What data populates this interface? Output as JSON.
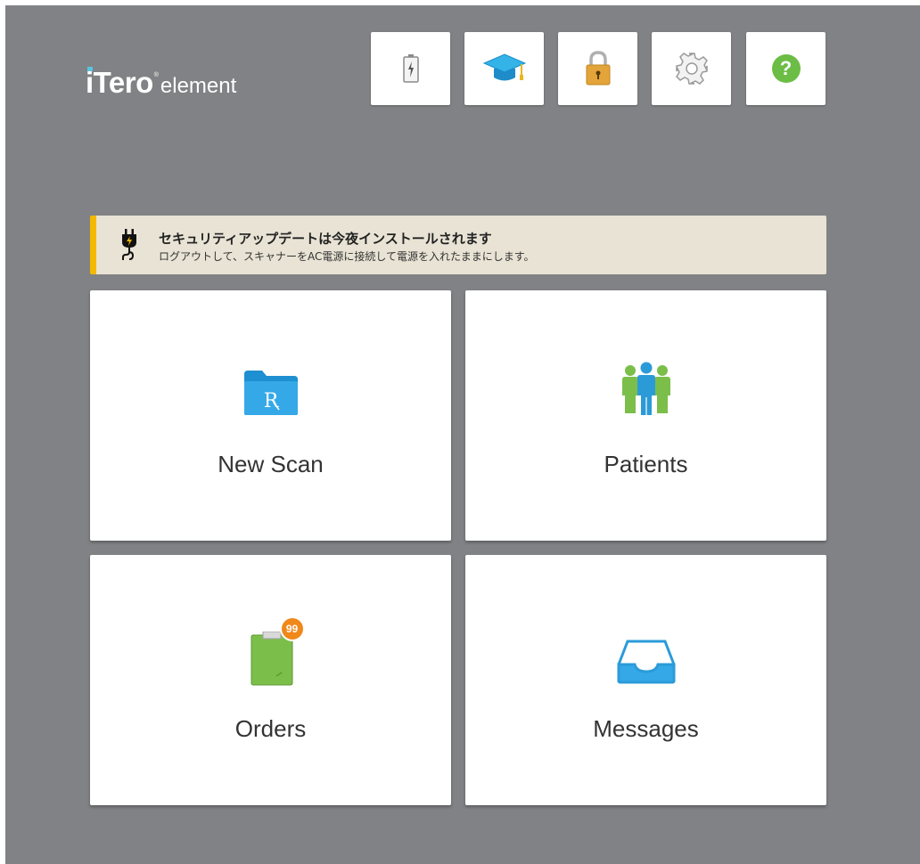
{
  "header": {
    "logo_text": "iTero",
    "logo_registered": "®",
    "logo_suffix": "element"
  },
  "toolbar": {
    "buttons": [
      {
        "name": "battery",
        "icon": "battery-charging-icon"
      },
      {
        "name": "learning",
        "icon": "graduation-cap-icon"
      },
      {
        "name": "lock",
        "icon": "padlock-icon"
      },
      {
        "name": "settings",
        "icon": "gear-icon"
      },
      {
        "name": "help",
        "icon": "question-mark-icon",
        "glyph": "?"
      }
    ]
  },
  "banner": {
    "title": "セキュリティアップデートは今夜インストールされます",
    "text": "ログアウトして、スキャナーをAC電源に接続して電源を入れたままにします。",
    "icon": "power-plug-icon",
    "accent": "#f5b800"
  },
  "tiles": {
    "new_scan": {
      "label": "New Scan",
      "icon": "rx-folder-icon",
      "icon_glyph": "R"
    },
    "patients": {
      "label": "Patients",
      "icon": "people-group-icon"
    },
    "orders": {
      "label": "Orders",
      "icon": "clipboard-icon",
      "badge": "99"
    },
    "messages": {
      "label": "Messages",
      "icon": "inbox-tray-icon"
    }
  },
  "colors": {
    "background": "#818285",
    "tile_bg": "#ffffff",
    "blue": "#2b9bd8",
    "green": "#7bbf4a",
    "badge": "#f0881a"
  }
}
